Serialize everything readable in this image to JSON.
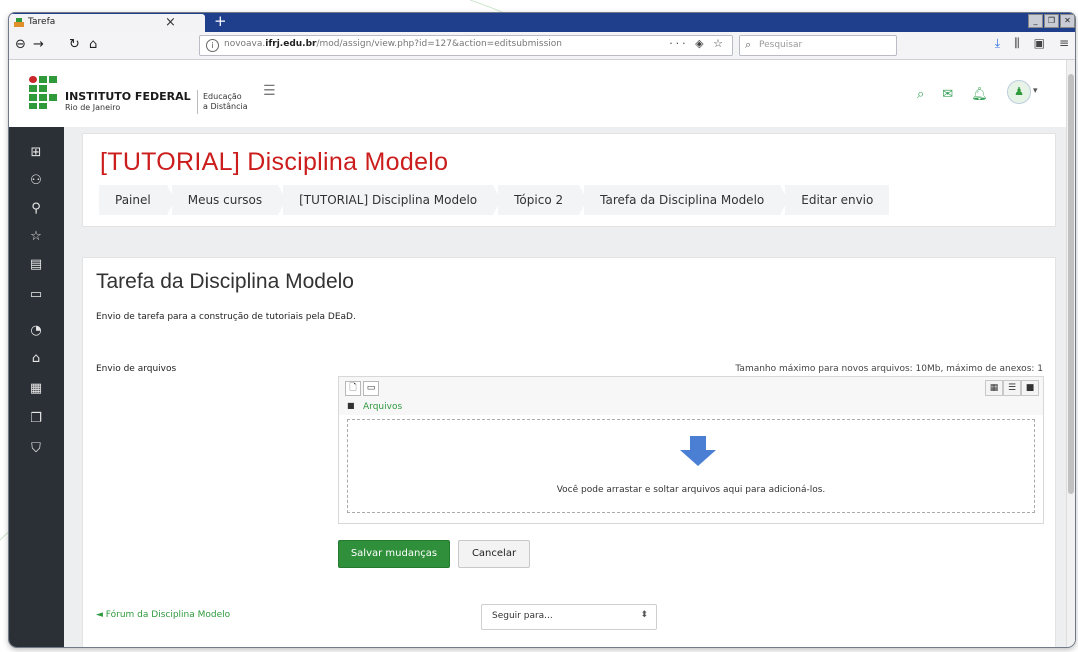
{
  "browser": {
    "tab_title": "Tarefa",
    "tab_close": "×",
    "new_tab": "+",
    "url_prefix": "novoava.",
    "url_domain": "ifrj.edu.br",
    "url_path": "/mod/assign/view.php?id=127&action=editsubmission",
    "url_actions": "··· ◈ ☆",
    "search_placeholder": "Pesquisar"
  },
  "header": {
    "institution": "INSTITUTO FEDERAL",
    "campus": "Rio de Janeiro",
    "ead_line1": "Educação",
    "ead_line2": "a Distância"
  },
  "course": {
    "title": "[TUTORIAL] Disciplina Modelo"
  },
  "breadcrumbs": [
    "Painel",
    "Meus cursos",
    "[TUTORIAL] Disciplina Modelo",
    "Tópico 2",
    "Tarefa da Disciplina Modelo",
    "Editar envio"
  ],
  "assignment": {
    "title": "Tarefa da Disciplina Modelo",
    "description": "Envio de tarefa para a construção de tutoriais pela DEaD.",
    "upload_label": "Envio de arquivos",
    "upload_limits": "Tamanho máximo para novos arquivos: 10Mb, máximo de anexos: 1",
    "folder_label": "Arquivos",
    "dropzone_text": "Você pode arrastar e soltar arquivos aqui para adicioná-los."
  },
  "buttons": {
    "save": "Salvar mudanças",
    "cancel": "Cancelar"
  },
  "footer": {
    "prev_link": "◄ Fórum da Disciplina Modelo",
    "jump_to": "Seguir para..."
  },
  "colors": {
    "accent": "#2f8f3a",
    "course_title": "#cc1d1d",
    "tabbar": "#1f3f8c",
    "drawer": "#2b3036",
    "dropzone_arrow": "#4a7fd4"
  }
}
